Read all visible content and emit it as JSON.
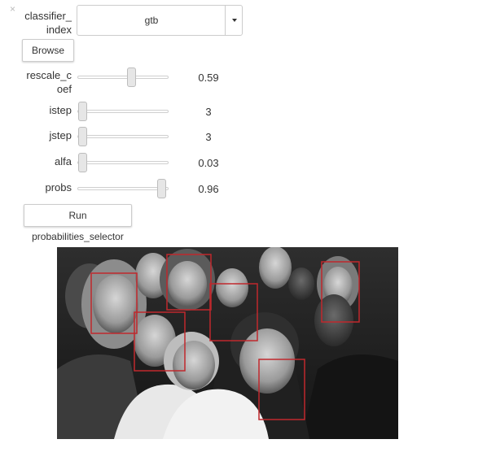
{
  "close_glyph": "×",
  "classifier": {
    "label": "classifier_\nindex",
    "label_line1": "classifier_",
    "label_line2": "index",
    "selected_value": "gtb"
  },
  "browse_button": {
    "label": "Browse"
  },
  "sliders": [
    {
      "key": "rescale_coef",
      "label_line1": "rescale_c",
      "label_line2": "oef",
      "value": "0.59",
      "fraction": 0.59
    },
    {
      "key": "istep",
      "label_line1": "istep",
      "label_line2": "",
      "value": "3",
      "fraction": 0.0
    },
    {
      "key": "jstep",
      "label_line1": "jstep",
      "label_line2": "",
      "value": "3",
      "fraction": 0.0
    },
    {
      "key": "alfa",
      "label_line1": "alfa",
      "label_line2": "",
      "value": "0.03",
      "fraction": 0.0
    },
    {
      "key": "probs",
      "label_line1": "probs",
      "label_line2": "",
      "value": "0.96",
      "fraction": 0.96
    }
  ],
  "run_button": {
    "label": "Run probabilities_selector"
  },
  "output_image": {
    "description_icon": "grayscale-group-selfie-photo",
    "detection_box_color": "#c0282d"
  },
  "colors": {
    "track_border": "#cfcfcf",
    "handle_fill": "#e6e6e6",
    "detection_box": "#c0282d"
  }
}
